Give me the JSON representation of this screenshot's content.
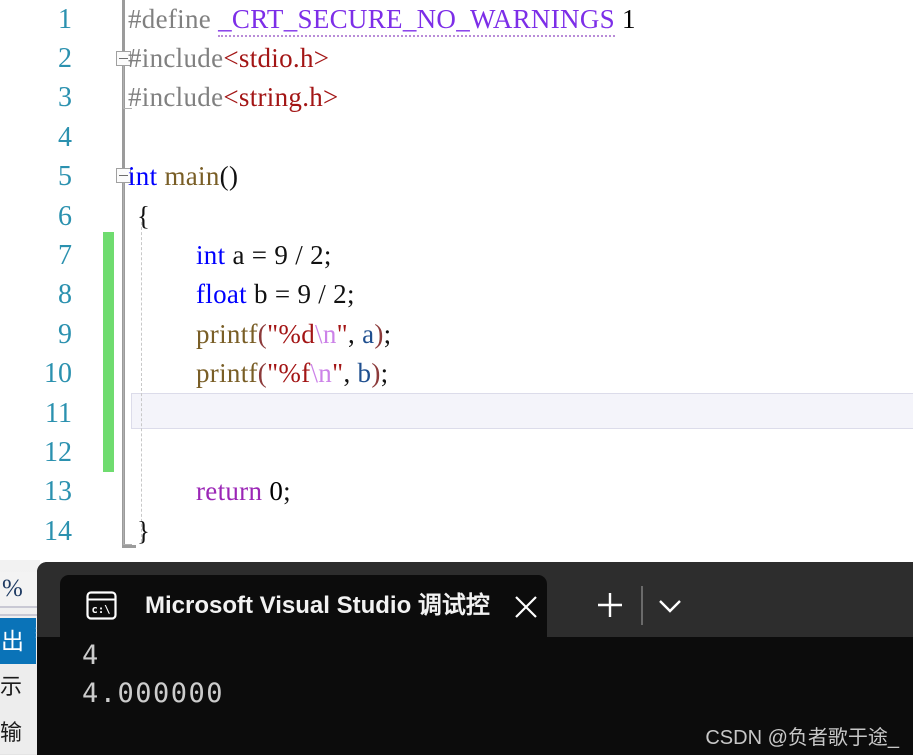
{
  "editor": {
    "line_numbers": [
      "1",
      "2",
      "3",
      "4",
      "5",
      "6",
      "7",
      "8",
      "9",
      "10",
      "11",
      "12",
      "13",
      "14"
    ],
    "lines": [
      {
        "n": "1",
        "text": "#define _CRT_SECURE_NO_WARNINGS 1"
      },
      {
        "n": "2",
        "text": "#include<stdio.h>"
      },
      {
        "n": "3",
        "text": "#include<string.h>"
      },
      {
        "n": "4",
        "text": ""
      },
      {
        "n": "5",
        "text": "int main()"
      },
      {
        "n": "6",
        "text": "{"
      },
      {
        "n": "7",
        "text": "    int a = 9 / 2;"
      },
      {
        "n": "8",
        "text": "    float b = 9 / 2;"
      },
      {
        "n": "9",
        "text": "    printf(\"%d\\n\", a);"
      },
      {
        "n": "10",
        "text": "    printf(\"%f\\n\", b);"
      },
      {
        "n": "11",
        "text": ""
      },
      {
        "n": "12",
        "text": ""
      },
      {
        "n": "13",
        "text": "    return 0;"
      },
      {
        "n": "14",
        "text": "}"
      }
    ],
    "tokens": {
      "define": "#define",
      "macro_name": "_CRT_SECURE_NO_WARNINGS",
      "macro_value": "1",
      "include": "#include",
      "header_stdio": "<stdio.h>",
      "header_string": "<string.h>",
      "kw_int": "int",
      "kw_float": "float",
      "fn_main": "main",
      "parens_empty": "()",
      "brace_open": "{",
      "brace_close": "}",
      "decl_a": " a = 9 / 2;",
      "decl_b": " b = 9 / 2;",
      "fn_printf": "printf",
      "p_open": "(",
      "p_close": ")",
      "str_d_open": "\"%d",
      "str_f_open": "\"%f",
      "esc_n": "\\n",
      "str_quote_close": "\"",
      "comma": ", ",
      "var_a": "a",
      "var_b": "b",
      "semicolon": ";",
      "kw_return": "return",
      "num_zero": "0"
    },
    "colors": {
      "line_number": "#2b91af",
      "preprocessor": "#808080",
      "macro": "#7d2ee8",
      "header_string": "#a31515",
      "keyword": "#0000ff",
      "function": "#795e26",
      "string": "#a31515",
      "escape": "#cc82e8",
      "control_keyword": "#9b26b6",
      "change_bar": "#6fdc6f",
      "current_line_bg": "#f4f4fa"
    }
  },
  "left_panel": {
    "zoom_label": "%",
    "active_tab_label": "出",
    "tab_overflow": "⋮",
    "body_label": "示输"
  },
  "terminal": {
    "tab_title": "Microsoft Visual Studio 调试控",
    "icon_name": "command-prompt-icon",
    "icon_glyph": "c:\\",
    "close_label": "✕",
    "new_tab_label": "+",
    "dropdown_label": "⌄",
    "output_lines": [
      "4",
      "4.000000"
    ],
    "background": "#0c0c0c",
    "titlebar_background": "#2d2d2d"
  },
  "watermark": {
    "text": "CSDN @负者歌于途_"
  }
}
